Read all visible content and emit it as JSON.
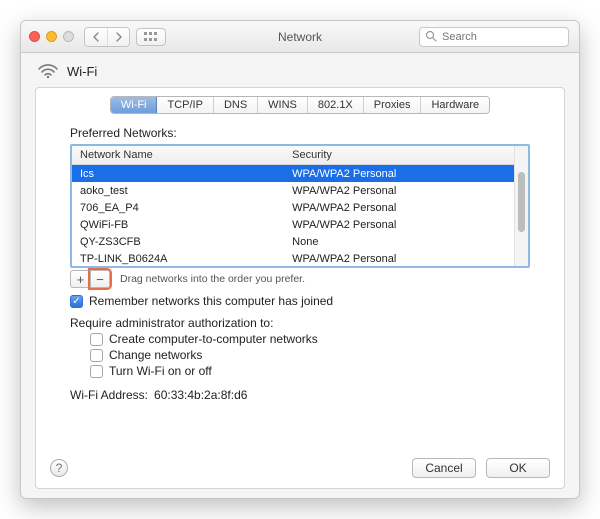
{
  "window": {
    "title": "Network",
    "search_placeholder": "Search"
  },
  "header": {
    "wifi_label": "Wi-Fi"
  },
  "tabs": [
    {
      "label": "Wi-Fi",
      "active": true
    },
    {
      "label": "TCP/IP"
    },
    {
      "label": "DNS"
    },
    {
      "label": "WINS"
    },
    {
      "label": "802.1X"
    },
    {
      "label": "Proxies"
    },
    {
      "label": "Hardware"
    }
  ],
  "preferred": {
    "label": "Preferred Networks:",
    "columns": {
      "name": "Network Name",
      "security": "Security"
    },
    "rows": [
      {
        "name": "Ics",
        "security": "WPA/WPA2 Personal",
        "selected": true
      },
      {
        "name": "aoko_test",
        "security": "WPA/WPA2 Personal"
      },
      {
        "name": "706_EA_P4",
        "security": "WPA/WPA2 Personal"
      },
      {
        "name": "QWiFi-FB",
        "security": "WPA/WPA2 Personal"
      },
      {
        "name": "QY-ZS3CFB",
        "security": "None"
      },
      {
        "name": "TP-LINK_B0624A",
        "security": "WPA/WPA2 Personal"
      }
    ],
    "drag_hint": "Drag networks into the order you prefer.",
    "add_symbol": "+",
    "remove_symbol": "−"
  },
  "remember": {
    "label": "Remember networks this computer has joined",
    "checked": true
  },
  "admin": {
    "label": "Require administrator authorization to:",
    "items": [
      {
        "label": "Create computer-to-computer networks",
        "checked": false
      },
      {
        "label": "Change networks",
        "checked": false
      },
      {
        "label": "Turn Wi-Fi on or off",
        "checked": false
      }
    ]
  },
  "wifi_address": {
    "label": "Wi-Fi Address:",
    "value": "60:33:4b:2a:8f:d6"
  },
  "buttons": {
    "help": "?",
    "cancel": "Cancel",
    "ok": "OK"
  }
}
